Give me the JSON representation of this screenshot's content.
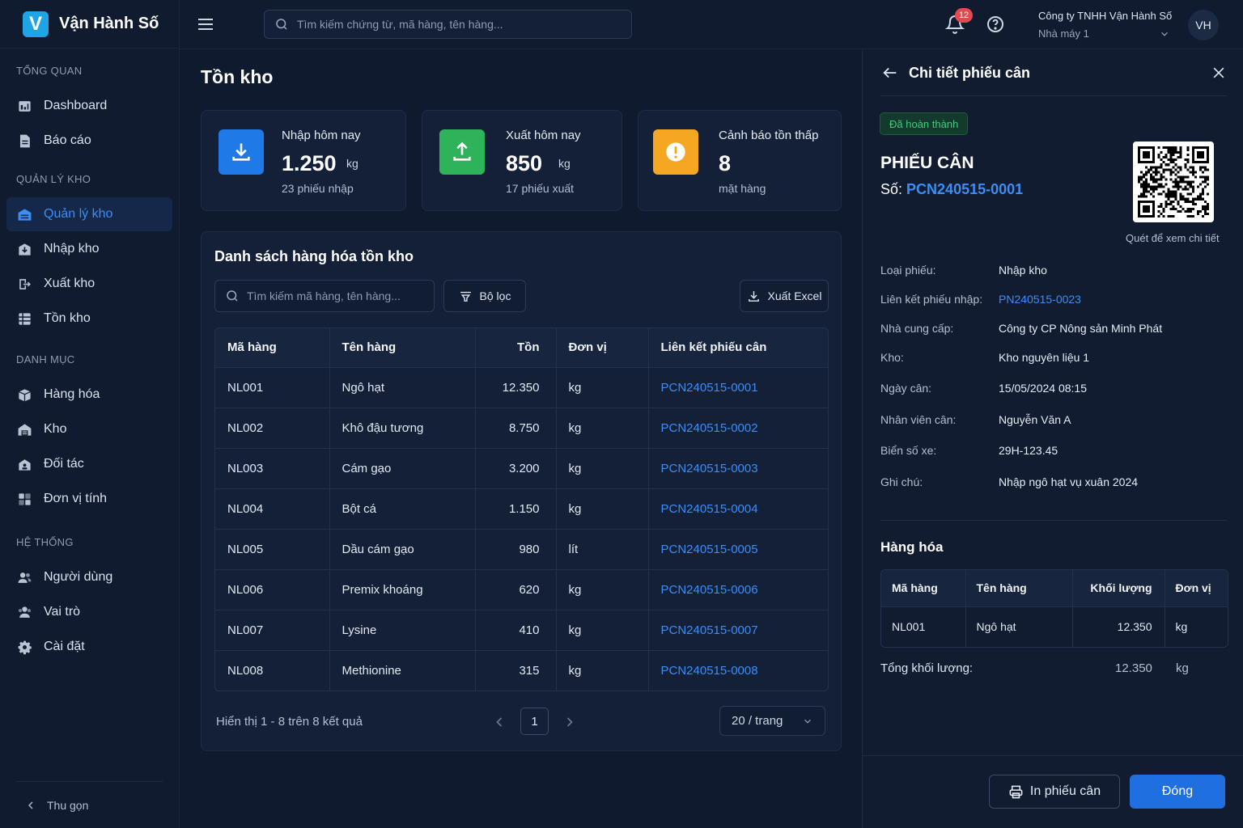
{
  "brand": {
    "logo_letter": "V",
    "name": "Vận Hành Số"
  },
  "sidebar": {
    "sections": [
      {
        "title": "TỔNG QUAN",
        "items": [
          {
            "label": "Dashboard",
            "icon": "dashboard-icon"
          },
          {
            "label": "Báo cáo",
            "icon": "report-icon"
          }
        ]
      },
      {
        "title": "QUẢN LÝ KHO",
        "items": [
          {
            "label": "Quản lý kho",
            "icon": "warehouse-icon",
            "active": true
          },
          {
            "label": "Nhập kho",
            "icon": "import-icon"
          },
          {
            "label": "Xuất kho",
            "icon": "export-icon"
          },
          {
            "label": "Tồn kho",
            "icon": "inventory-icon"
          }
        ]
      },
      {
        "title": "DANH MỤC",
        "items": [
          {
            "label": "Hàng hóa",
            "icon": "box-icon"
          },
          {
            "label": "Kho",
            "icon": "store-icon"
          },
          {
            "label": "Đối tác",
            "icon": "partner-icon"
          },
          {
            "label": "Đơn vị tính",
            "icon": "unit-icon"
          }
        ]
      },
      {
        "title": "HỆ THỐNG",
        "items": [
          {
            "label": "Người dùng",
            "icon": "users-icon"
          },
          {
            "label": "Vai trò",
            "icon": "role-icon"
          },
          {
            "label": "Cài đặt",
            "icon": "gear-icon"
          }
        ]
      }
    ],
    "collapse_label": "Thu gọn"
  },
  "topbar": {
    "search_placeholder": "Tìm kiếm chứng từ, mã hàng, tên hàng...",
    "notification_count": "12",
    "company": "Công ty TNHH Vận Hành Số",
    "plant": "Nhà máy 1",
    "avatar_initials": "VH"
  },
  "page": {
    "title": "Tồn kho"
  },
  "stats": [
    {
      "label": "Nhập hôm nay",
      "value": "1.250",
      "unit": "kg",
      "sub": "23 phiếu nhập",
      "color": "#1f7ae8",
      "icon": "download-icon"
    },
    {
      "label": "Xuất hôm nay",
      "value": "850",
      "unit": "kg",
      "sub": "17 phiếu xuất",
      "color": "#2fb35a",
      "icon": "upload-icon"
    },
    {
      "label": "Cảnh báo tồn thấp",
      "value": "8",
      "unit": "",
      "sub": "mặt hàng",
      "color": "#f5a623",
      "icon": "warning-icon"
    }
  ],
  "list": {
    "title": "Danh sách hàng hóa tồn kho",
    "search_placeholder": "Tìm kiếm mã hàng, tên hàng...",
    "filter_label": "Bộ lọc",
    "export_label": "Xuất Excel",
    "columns": [
      "Mã hàng",
      "Tên hàng",
      "Tồn",
      "Đơn vị",
      "Liên kết phiếu cân"
    ],
    "rows": [
      {
        "code": "NL001",
        "name": "Ngô hạt",
        "qty": "12.350",
        "unit": "kg",
        "slip": "PCN240515-0001"
      },
      {
        "code": "NL002",
        "name": "Khô đậu tương",
        "qty": "8.750",
        "unit": "kg",
        "slip": "PCN240515-0002"
      },
      {
        "code": "NL003",
        "name": "Cám gạo",
        "qty": "3.200",
        "unit": "kg",
        "slip": "PCN240515-0003"
      },
      {
        "code": "NL004",
        "name": "Bột cá",
        "qty": "1.150",
        "unit": "kg",
        "slip": "PCN240515-0004"
      },
      {
        "code": "NL005",
        "name": "Dầu cám gạo",
        "qty": "980",
        "unit": "lít",
        "slip": "PCN240515-0005"
      },
      {
        "code": "NL006",
        "name": "Premix khoáng",
        "qty": "620",
        "unit": "kg",
        "slip": "PCN240515-0006"
      },
      {
        "code": "NL007",
        "name": "Lysine",
        "qty": "410",
        "unit": "kg",
        "slip": "PCN240515-0007"
      },
      {
        "code": "NL008",
        "name": "Methionine",
        "qty": "315",
        "unit": "kg",
        "slip": "PCN240515-0008"
      }
    ],
    "pagination": {
      "info": "Hiển thị 1 - 8 trên 8 kết quả",
      "current_page": "1",
      "page_size": "20 / trang"
    }
  },
  "drawer": {
    "title": "Chi tiết phiếu cân",
    "status": "Đã hoàn thành",
    "heading": "PHIẾU CÂN",
    "number_label": "Số:",
    "number": "PCN240515-0001",
    "qr_caption": "Quét để xem chi tiết",
    "fields": [
      {
        "key": "Loại phiếu:",
        "value": "Nhập kho"
      },
      {
        "key": "Liên kết phiếu nhập:",
        "value": "PN240515-0023",
        "link": true
      },
      {
        "key": "Nhà cung cấp:",
        "value": "Công ty CP Nông sản Minh Phát"
      },
      {
        "key": "Kho:",
        "value": "Kho nguyên liệu 1"
      },
      {
        "key": "Ngày cân:",
        "value": "15/05/2024 08:15"
      },
      {
        "key": "Nhân viên cân:",
        "value": "Nguyễn Văn A"
      },
      {
        "key": "Biển số xe:",
        "value": "29H-123.45"
      },
      {
        "key": "Ghi chú:",
        "value": "Nhập ngô hạt vụ xuân 2024"
      }
    ],
    "goods": {
      "title": "Hàng hóa",
      "columns": [
        "Mã hàng",
        "Tên hàng",
        "Khối lượng",
        "Đơn vị"
      ],
      "rows": [
        {
          "code": "NL001",
          "name": "Ngô hạt",
          "weight": "12.350",
          "unit": "kg"
        }
      ]
    },
    "total_label": "Tổng khối lượng:",
    "total_value": "12.350",
    "total_unit": "kg",
    "print_label": "In phiếu cân",
    "close_label": "Đóng"
  }
}
